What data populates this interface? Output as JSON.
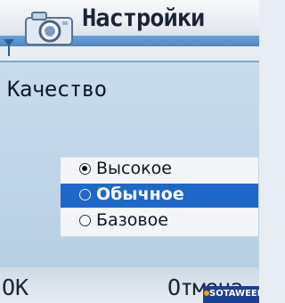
{
  "header": {
    "title": "Настройки",
    "icon": "camera-icon"
  },
  "field": {
    "label": "Качество"
  },
  "options": [
    {
      "label": "Высокое",
      "selected": true,
      "highlighted": false
    },
    {
      "label": "Обычное",
      "selected": false,
      "highlighted": true
    },
    {
      "label": "Базовое",
      "selected": false,
      "highlighted": false
    }
  ],
  "softkeys": {
    "left": "OK",
    "right": "Отмена"
  },
  "watermark": {
    "text": "SOTAWEEK"
  },
  "colors": {
    "highlight": "#1f67c8",
    "panel": "#c8dced",
    "header_strip": "#4f86c8"
  }
}
